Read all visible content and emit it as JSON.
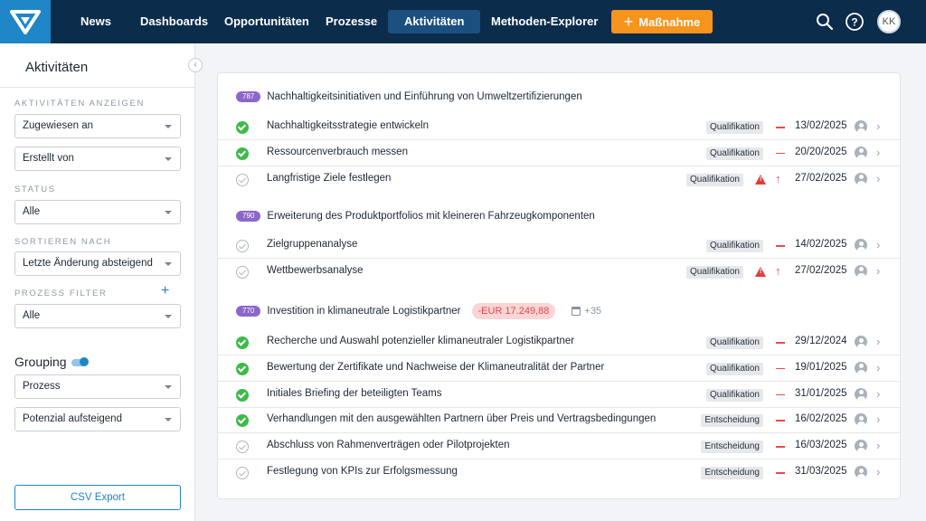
{
  "nav": {
    "items": [
      "News",
      "Dashboards",
      "Opportunitäten",
      "Prozesse",
      "Aktivitäten",
      "Methoden-Explorer"
    ],
    "active": "Aktivitäten",
    "cta_label": "Maßnahme",
    "avatar_initials": "KK",
    "icons": [
      "search-icon",
      "help-icon"
    ],
    "colors": {
      "bar": "#0c2c4c",
      "logo": "#1f86c8",
      "cta": "#f7941d",
      "active": "#1b4f7f"
    }
  },
  "sidebar": {
    "title": "Aktivitäten",
    "show_label": "AKTIVITÄTEN ANZEIGEN",
    "assigned": "Zugewiesen an",
    "created_by": "Erstellt von",
    "status_label": "STATUS",
    "status_value": "Alle",
    "sort_label": "SORTIEREN NACH",
    "sort_value": "Letzte Änderung absteigend",
    "process_filter_label": "PROZESS FILTER",
    "process_filter_value": "Alle",
    "grouping_label": "Grouping",
    "grouping_enabled": true,
    "group_by": "Prozess",
    "group_order": "Potenzial aufsteigend",
    "csv_label": "CSV Export"
  },
  "groups": [
    {
      "id": "787",
      "title": "Nachhaltigkeitsinitiativen und Einführung von Umweltzertifizierungen",
      "rows": [
        {
          "title": "Nachhaltigkeitsstrategie entwickeln",
          "done": true,
          "tag": "Qualifikation",
          "warning": false,
          "priority": "dash",
          "date": "13/02/2025"
        },
        {
          "title": "Ressourcenverbrauch messen",
          "done": true,
          "tag": "Qualifikation",
          "warning": false,
          "priority": "dash",
          "date": "20/20/2025"
        },
        {
          "title": "Langfristige Ziele festlegen",
          "done": false,
          "tag": "Qualifikation",
          "warning": true,
          "priority": "up",
          "date": "27/02/2025"
        }
      ]
    },
    {
      "id": "790",
      "title": "Erweiterung des Produktportfolios mit kleineren Fahrzeugkomponenten",
      "rows": [
        {
          "title": "Zielgruppenanalyse",
          "done": false,
          "tag": "Qualifikation",
          "warning": false,
          "priority": "dash",
          "date": "14/02/2025"
        },
        {
          "title": "Wettbewerbsanalyse",
          "done": false,
          "tag": "Qualifikation",
          "warning": true,
          "priority": "up",
          "date": "27/02/2025"
        }
      ]
    },
    {
      "id": "770",
      "title": "Investition in klimaneutrale Logistikpartner",
      "amount": "-EUR 17.249,88",
      "extra_count": "+35",
      "rows": [
        {
          "title": "Recherche und Auswahl potenzieller klimaneutraler Logistikpartner",
          "done": true,
          "tag": "Qualifikation",
          "warning": false,
          "priority": "dash",
          "date": "29/12/2024"
        },
        {
          "title": "Bewertung der Zertifikate und Nachweise der Klimaneutralität der Partner",
          "done": true,
          "tag": "Qualifikation",
          "warning": false,
          "priority": "dash",
          "date": "19/01/2025"
        },
        {
          "title": "Initiales Briefing der beteiligten Teams",
          "done": true,
          "tag": "Qualifikation",
          "warning": false,
          "priority": "dash",
          "date": "31/01/2025"
        },
        {
          "title": "Verhandlungen mit den ausgewählten Partnern über Preis und Vertragsbedingungen",
          "done": true,
          "tag": "Entscheidung",
          "warning": false,
          "priority": "dash",
          "date": "16/02/2025"
        },
        {
          "title": "Abschluss von Rahmenverträgen oder Pilotprojekten",
          "done": false,
          "tag": "Entscheidung",
          "warning": false,
          "priority": "dash",
          "date": "16/03/2025"
        },
        {
          "title": "Festlegung von KPIs zur Erfolgsmessung",
          "done": false,
          "tag": "Entscheidung",
          "warning": false,
          "priority": "dash",
          "date": "31/03/2025"
        }
      ]
    }
  ]
}
